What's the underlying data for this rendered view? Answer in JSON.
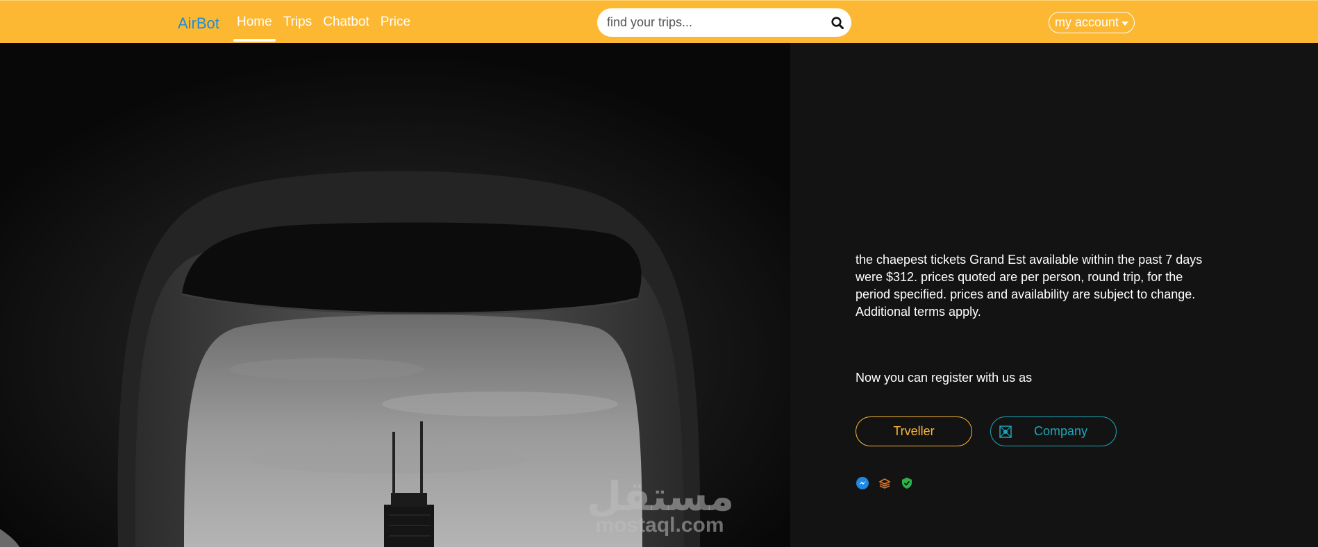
{
  "header": {
    "brand": "AirBot",
    "nav": [
      {
        "label": "Home",
        "active": true
      },
      {
        "label": "Trips",
        "active": false
      },
      {
        "label": "Chatbot",
        "active": false
      },
      {
        "label": "Price",
        "active": false
      }
    ],
    "search": {
      "placeholder": "find your trips...",
      "value": "",
      "icon": "search-icon"
    },
    "account_label": "my account"
  },
  "panel": {
    "description": "the chaepest tickets Grand Est available within the past 7 days were $312. prices quoted are per person, round trip, for the period specified. prices and availability are subject to change. Additional terms apply.",
    "register_text": "Now you can register with us as",
    "buttons": {
      "traveller": "Trveller",
      "company": "Company"
    },
    "social_icons": [
      "messenger-icon",
      "stack-icon",
      "shield-icon"
    ]
  },
  "watermark": {
    "arabic": "مستقل",
    "latin": "mostaql.com"
  },
  "colors": {
    "header_bg": "#fdb833",
    "brand": "#1e8fd6",
    "panel_bg": "#131313",
    "traveller_accent": "#fdb833",
    "company_accent": "#1ba8bd"
  }
}
